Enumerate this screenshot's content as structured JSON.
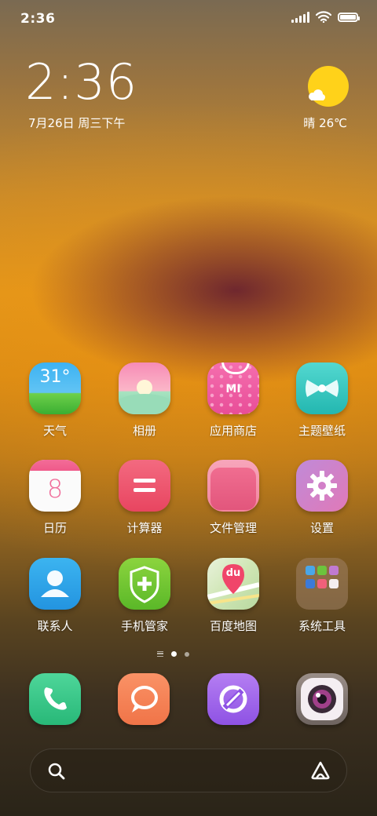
{
  "status_bar": {
    "time": "2:36"
  },
  "clock_widget": {
    "time": "2:36",
    "date": "7月26日 周三下午"
  },
  "weather_widget": {
    "text": "晴 26℃"
  },
  "apps": [
    {
      "label": "天气",
      "icon": "weather-icon",
      "badge": "31°"
    },
    {
      "label": "相册",
      "icon": "gallery-icon"
    },
    {
      "label": "应用商店",
      "icon": "app-store-icon",
      "badge": "mi"
    },
    {
      "label": "主题壁纸",
      "icon": "themes-bow-icon"
    },
    {
      "label": "日历",
      "icon": "calendar-icon",
      "badge": "8"
    },
    {
      "label": "计算器",
      "icon": "calculator-icon"
    },
    {
      "label": "文件管理",
      "icon": "file-manager-icon"
    },
    {
      "label": "设置",
      "icon": "gear-icon"
    },
    {
      "label": "联系人",
      "icon": "contacts-icon"
    },
    {
      "label": "手机管家",
      "icon": "security-shield-icon"
    },
    {
      "label": "百度地图",
      "icon": "baidu-map-icon",
      "badge": "du"
    },
    {
      "label": "系统工具",
      "icon": "folder-icon"
    }
  ],
  "dock": [
    {
      "icon": "phone-icon"
    },
    {
      "icon": "messages-icon"
    },
    {
      "icon": "browser-icon"
    },
    {
      "icon": "camera-icon"
    }
  ],
  "search_bar": {
    "icons": [
      "search-icon",
      "assistant-icon"
    ]
  },
  "colors": {
    "sun": "#ffd21a",
    "accent_pink": "#f06c9a"
  }
}
